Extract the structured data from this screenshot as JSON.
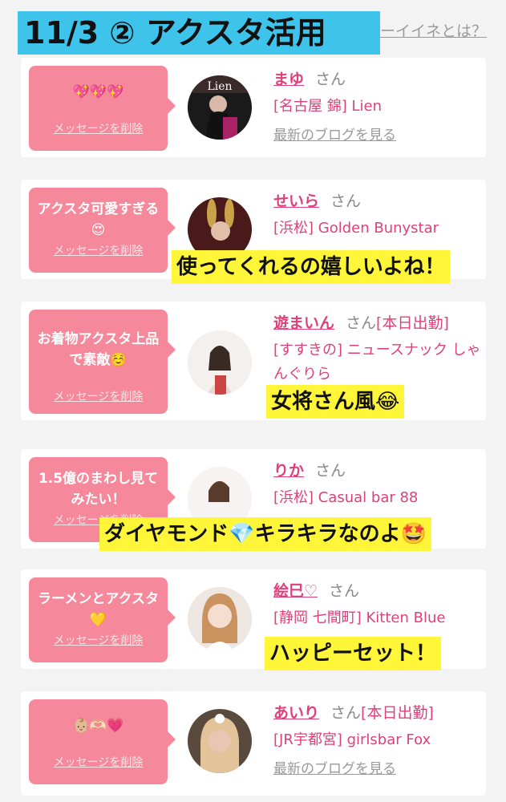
{
  "title": "11/3 ② アクスタ活用",
  "top_link": "ーイイネとは？",
  "delete_label": "メッセージを削除",
  "san_label": "さん",
  "blog_label": "最新のブログを見る",
  "cards": [
    {
      "message": "💖💖💖",
      "name": "まゆ",
      "shift": "",
      "shop": "[名古屋 錦] Lien",
      "overlay": ""
    },
    {
      "message": "アクスタ可愛すぎる😍",
      "name": "せいら",
      "shift": "",
      "shop": "[浜松] Golden Bunystar",
      "overlay": "使ってくれるの嬉しいよね！"
    },
    {
      "message": "お着物アクスタ上品で素敵☺️",
      "name": "遊まいん",
      "shift": "[本日出勤]",
      "shop": "[すすきの] ニュースナック しゃんぐりら",
      "overlay": "女将さん風😂"
    },
    {
      "message": "1.5億のまわし見てみたい！",
      "name": "りか",
      "shift": "",
      "shop": "[浜松] Casual bar 88",
      "overlay": "ダイヤモンド💎キラキラなのよ🤩"
    },
    {
      "message": "ラーメンとアクスタ💛",
      "name": "絵巳♡",
      "shift": "",
      "shop": "[静岡 七間町] Kitten Blue",
      "overlay": "ハッピーセット！"
    },
    {
      "message": "👶🏼🫶🏻💗",
      "name": "あいり",
      "shift": "[本日出勤]",
      "shop": "[JR宇都宮] girlsbar Fox",
      "overlay": ""
    }
  ],
  "colors": {
    "banner": "#3ec3ea",
    "bubble": "#f5889a",
    "accent": "#e0407a",
    "highlight": "#fff63a"
  }
}
